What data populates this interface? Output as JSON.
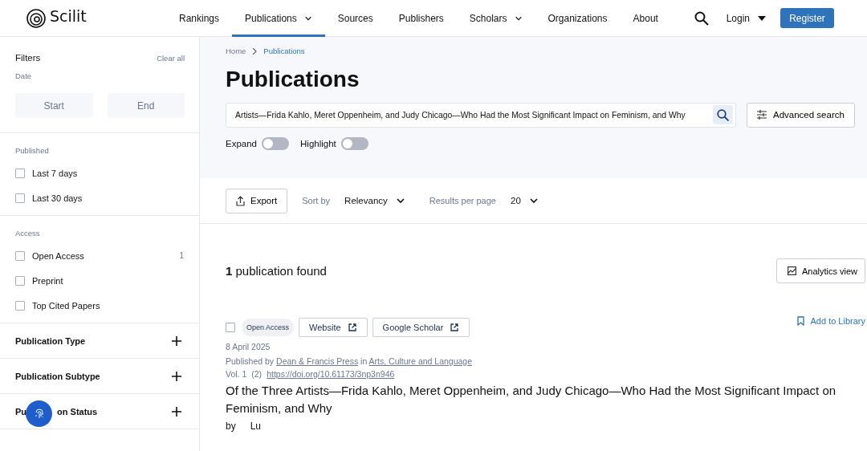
{
  "logo": {
    "text": "Scilit"
  },
  "nav": [
    {
      "label": "Rankings",
      "selected": false,
      "dropdown": false
    },
    {
      "label": "Publications",
      "selected": true,
      "dropdown": true
    },
    {
      "label": "Sources",
      "selected": false,
      "dropdown": false
    },
    {
      "label": "Publishers",
      "selected": false,
      "dropdown": false
    },
    {
      "label": "Scholars",
      "selected": false,
      "dropdown": true
    },
    {
      "label": "Organizations",
      "selected": false,
      "dropdown": false
    },
    {
      "label": "About",
      "selected": false,
      "dropdown": false
    }
  ],
  "login": "Login",
  "register": "Register",
  "filters": {
    "title": "Filters",
    "clear": "Clear all",
    "date_label": "Date",
    "start": "Start",
    "end": "End",
    "groups": [
      {
        "title": "Published",
        "options": [
          {
            "label": "Last 7 days",
            "checked": false
          },
          {
            "label": "Last 30 days",
            "checked": false
          }
        ]
      },
      {
        "title": "Access",
        "options": [
          {
            "label": "Open Access",
            "checked": false,
            "count": "1"
          },
          {
            "label": "Preprint",
            "checked": false
          },
          {
            "label": "Top Cited Papers",
            "checked": false
          }
        ]
      }
    ],
    "sections": [
      {
        "title": "Publication Type",
        "expanded": false
      },
      {
        "title": "Publication Subtype",
        "expanded": false
      },
      {
        "title_parts": [
          "Pu",
          "on Status"
        ],
        "expanded": false
      }
    ]
  },
  "breadcrumb": [
    {
      "label": "Home",
      "selected": false
    },
    {
      "label": "Publications",
      "selected": true
    }
  ],
  "page_title": "Publications",
  "search": {
    "value": "Artists—Frida Kahlo, Meret Oppenheim, and Judy Chicago—Who Had the Most Significant Impact on Feminism, and Why"
  },
  "advanced_search": "Advanced search",
  "toggles": [
    {
      "label": "Expand",
      "on": false
    },
    {
      "label": "Highlight",
      "on": false
    }
  ],
  "toolbar": {
    "export": "Export",
    "sort_label": "Sort by",
    "sort_value": "Relevancy",
    "per_page_label": "Results per page",
    "per_page_value": "20"
  },
  "results_count": "**1** publication found",
  "analytics_view": "Analytics view",
  "results": [
    {
      "checked": false,
      "access_badge": "Open Access",
      "links": [
        "Website",
        "Google Scholar"
      ],
      "add_to_library": "Add to Library",
      "date": "8 April 2025",
      "published_prefix": "Published by",
      "publisher": "Dean & Francis Press",
      "in_word": "in",
      "journal": "Arts, Culture and Language",
      "volume": "Vol. 1",
      "issue": "(2)",
      "doi": "https://doi.org/10.61173/3np3n946",
      "title": "Of the Three Artists—Frida Kahlo, Meret Oppenheim, and Judy Chicago—Who Had the Most Significant Impact on Feminism, and Why",
      "by_label": "by",
      "authors": [
        "Lu"
      ]
    }
  ]
}
